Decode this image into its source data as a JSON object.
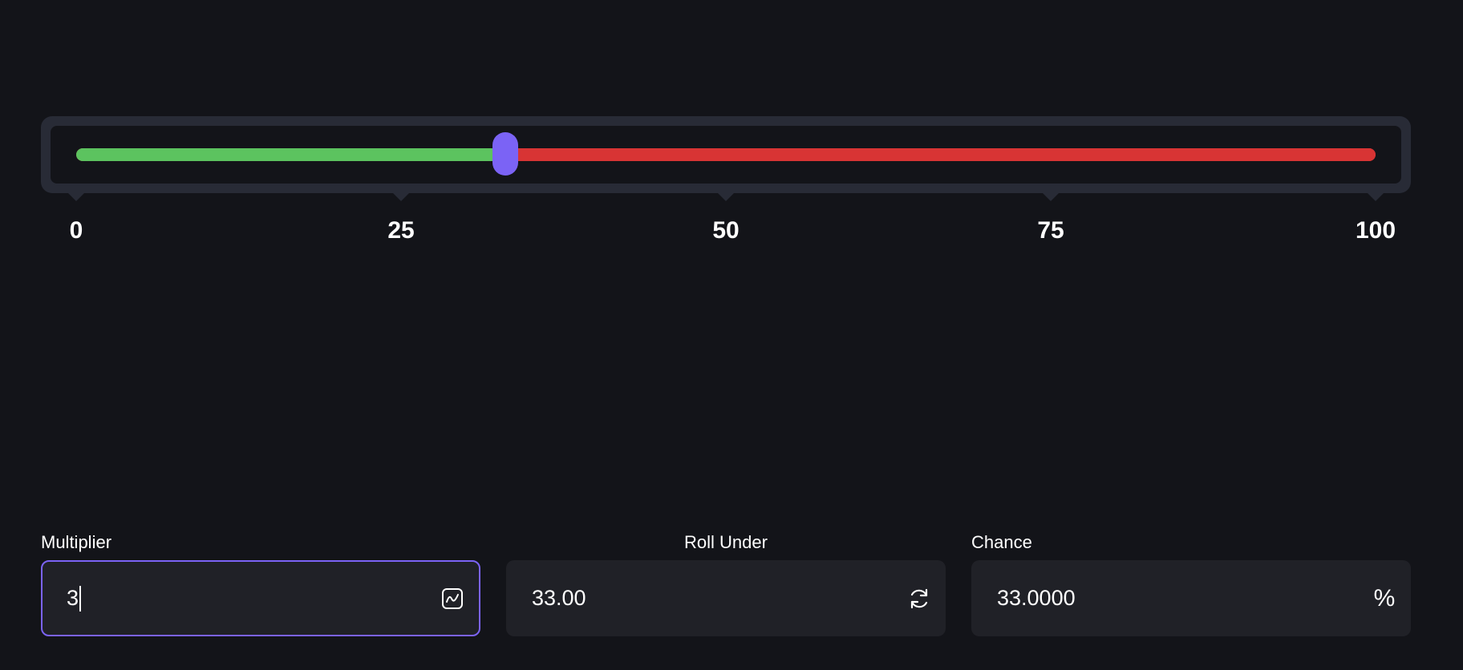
{
  "slider": {
    "min": 0,
    "max": 100,
    "value": 33.0,
    "ticks": [
      "0",
      "25",
      "50",
      "75",
      "100"
    ],
    "colors": {
      "win": "#5cc35f",
      "lose": "#d83434",
      "thumb": "#7b63f5"
    }
  },
  "fields": {
    "multiplier": {
      "label": "Multiplier",
      "value": "3",
      "icon": "chart-icon",
      "focused": true
    },
    "roll_under": {
      "label": "Roll Under",
      "value": "33.00",
      "icon": "refresh-icon"
    },
    "chance": {
      "label": "Chance",
      "value": "33.0000",
      "icon": "percent-icon",
      "icon_glyph": "%"
    }
  }
}
